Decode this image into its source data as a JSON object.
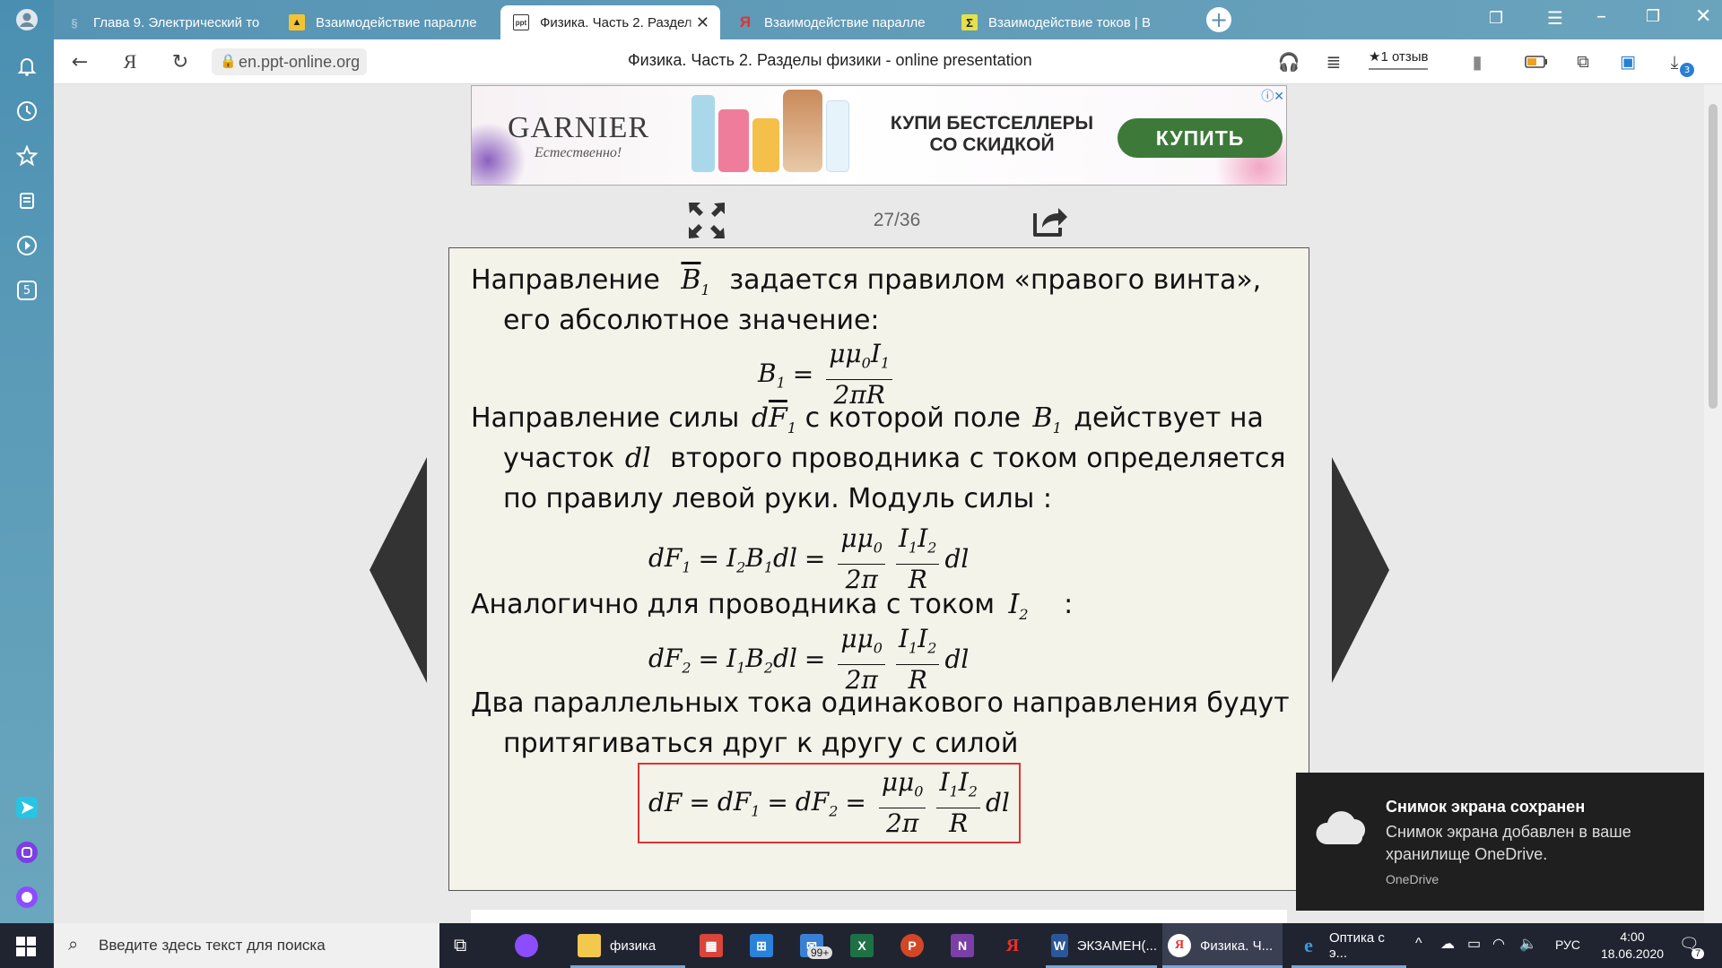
{
  "browser": {
    "tabs": [
      {
        "label": "Глава 9. Электрический то",
        "favicon": "§",
        "active": false
      },
      {
        "label": "Взаимодействие паралле",
        "favicon": "▲",
        "active": false
      },
      {
        "label": "Физика. Часть 2. Раздел",
        "favicon": "ppt",
        "active": true
      },
      {
        "label": "Взаимодействие паралле",
        "favicon": "Я",
        "active": false
      },
      {
        "label": "Взаимодействие токов | В",
        "favicon": "Σ",
        "active": false
      }
    ],
    "new_tab_symbol": "+",
    "url": "en.ppt-online.org",
    "page_title": "Физика. Часть 2. Разделы физики - online presentation",
    "reviews_label": "★1 отзыв",
    "download_badge": "3",
    "yandex_symbol": "Я"
  },
  "sidebar": {
    "items": [
      "bell",
      "history",
      "bookmarks",
      "collections",
      "video",
      "counter"
    ],
    "counter_label": "5"
  },
  "ad": {
    "brand": "GARNIER",
    "tagline": "Естественно!",
    "promo_line1": "КУПИ БЕСТСЕЛЛЕРЫ",
    "promo_line2": "СО СКИДКОЙ",
    "buy_label": "КУПИТЬ",
    "close_label": "ⓘ✕"
  },
  "slide": {
    "counter": "27/36",
    "l1a": "Направление",
    "l1b": "задается правилом «правого винта»,",
    "l2": "его абсолютное значение:",
    "l3a": "Направление   силы",
    "l3b": "с которой поле",
    "l3c": "действует на",
    "l4a": "участок",
    "l4b": "второго проводника с током определяется",
    "l5": "по правилу левой руки. Модуль силы :",
    "l6a": "Аналогично для проводника с током",
    "l6b": ":",
    "l7": "Два параллельных тока одинакового направления будут",
    "l8": "притягиваться друг к другу с силой"
  },
  "notification": {
    "title": "Снимок экрана сохранен",
    "body": "Снимок экрана добавлен в ваше хранилище OneDrive.",
    "source": "OneDrive"
  },
  "taskbar": {
    "search_placeholder": "Введите здесь текст для поиска",
    "apps": [
      {
        "label": "физика"
      },
      {
        "label": "ЭКЗАМЕН(..."
      },
      {
        "label": "Физика. Ч..."
      },
      {
        "label": "Оптика с э..."
      }
    ],
    "mail_badge": "99+",
    "language": "РУС",
    "time": "4:00",
    "date": "18.06.2020",
    "notif_badge": "7"
  }
}
